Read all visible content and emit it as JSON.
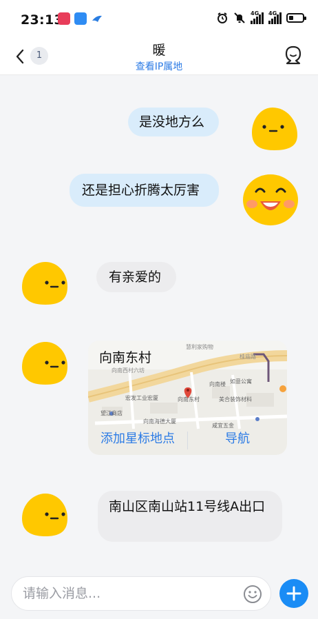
{
  "status_bar": {
    "time": "23:13",
    "network_1": "4G",
    "network_2": "4G"
  },
  "header": {
    "title": "暖",
    "subtitle_link": "查看IP属地",
    "unread_count": "1"
  },
  "messages": [
    {
      "direction": "outgoing",
      "text": "是没地方么"
    },
    {
      "direction": "outgoing",
      "text": "还是担心折腾太厉害"
    },
    {
      "direction": "incoming",
      "text": "有亲爱的"
    },
    {
      "direction": "incoming",
      "type": "location"
    },
    {
      "direction": "incoming",
      "text": "南山区南山站11号线A出口"
    }
  ],
  "location_card": {
    "place_name": "向南东村",
    "action_star": "添加星标地点",
    "action_navigate": "导航",
    "map_labels": [
      "慧利家购物",
      "向南西村六坊",
      "向南楼",
      "如意公寓",
      "宏发工业宏厦",
      "向南东村",
      "美合装饰材料",
      "望江商店",
      "向南海德大厦",
      "咸宜五金",
      "桂庙路"
    ]
  },
  "input": {
    "placeholder": "请输入消息..."
  },
  "colors": {
    "accent": "#2c7be5",
    "outgoing_bubble": "#d9ecfb",
    "incoming_bubble": "#ececee",
    "send_button": "#1a8cf5"
  }
}
